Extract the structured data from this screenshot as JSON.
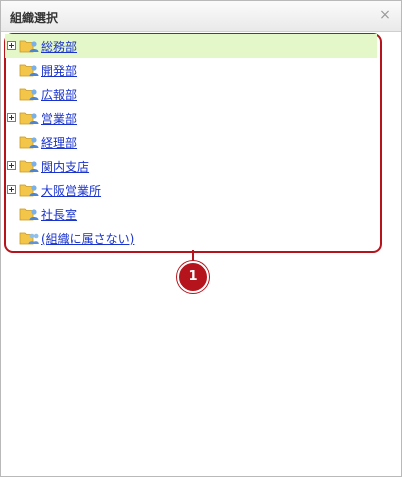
{
  "dialog": {
    "title": "組織選択",
    "close_glyph": "×"
  },
  "tree": {
    "items": [
      {
        "label": "総務部",
        "expandable": true,
        "selected": true,
        "icon": "org-folder-icon"
      },
      {
        "label": "開発部",
        "expandable": false,
        "selected": false,
        "icon": "org-folder-icon"
      },
      {
        "label": "広報部",
        "expandable": false,
        "selected": false,
        "icon": "org-folder-icon"
      },
      {
        "label": "営業部",
        "expandable": true,
        "selected": false,
        "icon": "org-folder-icon"
      },
      {
        "label": "経理部",
        "expandable": false,
        "selected": false,
        "icon": "org-folder-icon"
      },
      {
        "label": "関内支店",
        "expandable": true,
        "selected": false,
        "icon": "org-folder-icon"
      },
      {
        "label": "大阪営業所",
        "expandable": true,
        "selected": false,
        "icon": "org-folder-icon"
      },
      {
        "label": "社長室",
        "expandable": false,
        "selected": false,
        "icon": "org-folder-icon"
      },
      {
        "label": "(組織に属さない)",
        "expandable": false,
        "selected": false,
        "icon": "no-org-folder-icon"
      }
    ]
  },
  "callout": {
    "number": "1"
  },
  "colors": {
    "accent": "#b5141c",
    "link": "#1a33cc",
    "selected_row": "#e3f7c9"
  }
}
